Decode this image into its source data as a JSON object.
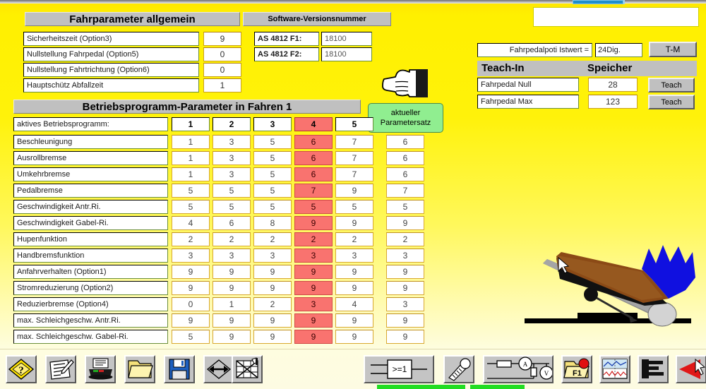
{
  "window": {
    "tab_color": "#1f8ec9"
  },
  "fahrparameter": {
    "title": "Fahrparameter allgemein",
    "rows": [
      {
        "label": "Sicherheitszeit (Option3)",
        "value": "9"
      },
      {
        "label": "Nullstellung Fahrpedal (Option5)",
        "value": "0"
      },
      {
        "label": "Nullstellung Fahrtrichtung (Option6)",
        "value": "0"
      },
      {
        "label": "Hauptschütz Abfallzeit",
        "value": "1"
      }
    ]
  },
  "software": {
    "title": "Software-Versionsnummer",
    "rows": [
      {
        "label": "AS 4812 F1:",
        "value": "18100"
      },
      {
        "label": "AS 4812 F2:",
        "value": "18100"
      }
    ]
  },
  "teachin": {
    "istwert_label": "Fahrpedalpoti Istwert =",
    "istwert_value": "24Dig.",
    "tm_button": "T-M",
    "header_left": "Teach-In",
    "header_right": "Speicher",
    "rows": [
      {
        "label": "Fahrpedal Null",
        "value": "28",
        "button": "Teach"
      },
      {
        "label": "Fahrpedal Max",
        "value": "123",
        "button": "Teach"
      }
    ]
  },
  "betriebsprogramm": {
    "title": "Betriebsprogramm-Parameter in Fahren 1",
    "active_set_label_line1": "aktueller",
    "active_set_label_line2": "Parametersatz",
    "active_program_label": "aktives Betriebsprogramm:",
    "program_columns": [
      "1",
      "2",
      "3",
      "4",
      "5"
    ],
    "highlighted_column": 3,
    "rows": [
      {
        "label": "Beschleunigung",
        "values": [
          "1",
          "3",
          "5",
          "6",
          "7"
        ],
        "active": "6"
      },
      {
        "label": "Ausrollbremse",
        "values": [
          "1",
          "3",
          "5",
          "6",
          "7"
        ],
        "active": "6"
      },
      {
        "label": "Umkehrbremse",
        "values": [
          "1",
          "3",
          "5",
          "6",
          "7"
        ],
        "active": "6"
      },
      {
        "label": "Pedalbremse",
        "values": [
          "5",
          "5",
          "5",
          "7",
          "9"
        ],
        "active": "7"
      },
      {
        "label": "Geschwindigkeit  Antr.Ri.",
        "values": [
          "5",
          "5",
          "5",
          "5",
          "5"
        ],
        "active": "5"
      },
      {
        "label": "Geschwindigkeit Gabel-Ri.",
        "values": [
          "4",
          "6",
          "8",
          "9",
          "9"
        ],
        "active": "9"
      },
      {
        "label": "Hupenfunktion",
        "values": [
          "2",
          "2",
          "2",
          "2",
          "2"
        ],
        "active": "2"
      },
      {
        "label": "Handbremsfunktion",
        "values": [
          "3",
          "3",
          "3",
          "3",
          "3"
        ],
        "active": "3"
      },
      {
        "label": "Anfahrverhalten (Option1)",
        "values": [
          "9",
          "9",
          "9",
          "9",
          "9"
        ],
        "active": "9"
      },
      {
        "label": "Stromreduzierung (Option2)",
        "values": [
          "9",
          "9",
          "9",
          "9",
          "9"
        ],
        "active": "9"
      },
      {
        "label": "Reduzierbremse (Option4)",
        "values": [
          "0",
          "1",
          "2",
          "3",
          "4"
        ],
        "active": "3"
      },
      {
        "label": "max. Schleichgeschw.  Antr.Ri.",
        "values": [
          "9",
          "9",
          "9",
          "9",
          "9"
        ],
        "active": "9"
      },
      {
        "label": "max. Schleichgeschw. Gabel-Ri.",
        "values": [
          "5",
          "9",
          "9",
          "9",
          "9"
        ],
        "active": "9"
      }
    ]
  },
  "toolbar": {
    "left_buttons": [
      {
        "name": "help-icon",
        "tooltip": "Hilfe"
      },
      {
        "name": "edit-note-icon",
        "tooltip": "Bearbeiten"
      },
      {
        "name": "printer-icon",
        "tooltip": "Drucken"
      },
      {
        "name": "folder-open-icon",
        "tooltip": "Öffnen"
      },
      {
        "name": "floppy-save-icon",
        "tooltip": "Speichern"
      },
      {
        "name": "exchange-icon",
        "tooltip": "Transfer"
      },
      {
        "name": "chart-cross-icon",
        "tooltip": "Diagramm aus"
      }
    ],
    "right_buttons": [
      {
        "name": "logic-gate-icon",
        "label": ">=1",
        "tooltip": "Logik"
      },
      {
        "name": "thermometer-icon",
        "tooltip": "Temperatur"
      },
      {
        "name": "circuit-meter-icon",
        "tooltip": "Messung"
      },
      {
        "name": "folder-f1-icon",
        "label": "F1",
        "tooltip": "F1 Datei"
      },
      {
        "name": "signal-plot-icon",
        "tooltip": "Signalverlauf"
      },
      {
        "name": "bar-steps-icon",
        "tooltip": "Stufen"
      },
      {
        "name": "red-arrow-icon",
        "tooltip": "Zurück"
      }
    ]
  },
  "colors": {
    "background_top": "#fff000",
    "background_bottom": "#fdfbe2",
    "highlight_red": "#f9736f",
    "accent_green": "#90ee90",
    "panel_gray": "#c0c0c0",
    "status_green": "#22dd22",
    "pedal_brown": "#8b4a16",
    "shoe_blue": "#1010e0"
  }
}
